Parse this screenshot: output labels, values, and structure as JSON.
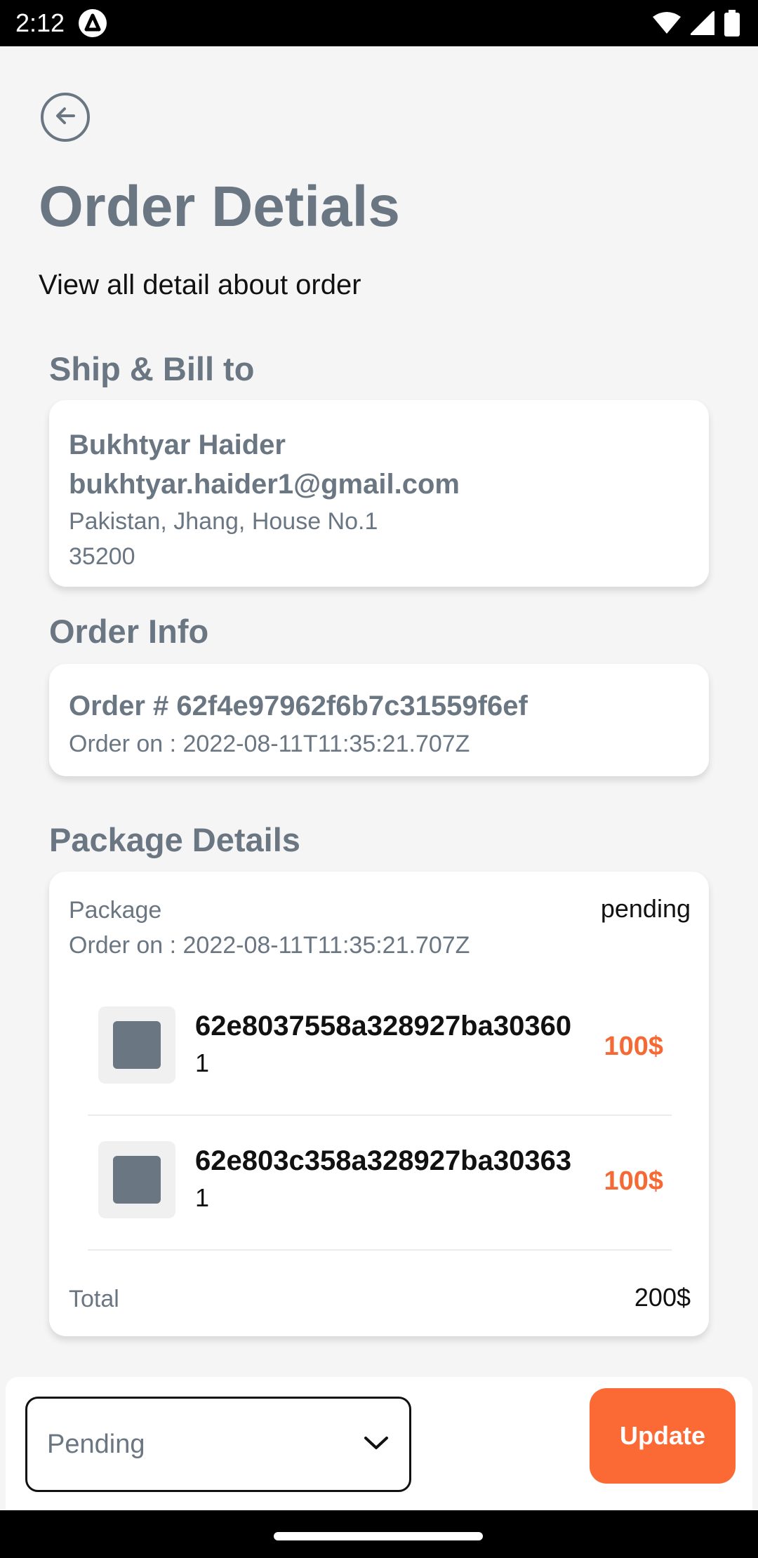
{
  "status_bar": {
    "time": "2:12",
    "icons": [
      "wifi-icon",
      "signal-icon",
      "battery-icon"
    ]
  },
  "header": {
    "title": "Order Detials",
    "subtitle": "View all detail about order"
  },
  "ship_bill": {
    "section_title": "Ship & Bill to",
    "name": "Bukhtyar Haider",
    "email": "bukhtyar.haider1@gmail.com",
    "address": "Pakistan, Jhang, House No.1",
    "postal_code": "35200"
  },
  "order_info": {
    "section_title": "Order Info",
    "order_id": "Order # 62f4e97962f6b7c31559f6ef",
    "order_date": "Order on : 2022-08-11T11:35:21.707Z"
  },
  "package": {
    "section_title": "Package Details",
    "label": "Package",
    "status": "pending",
    "order_date": "Order on : 2022-08-11T11:35:21.707Z",
    "items": [
      {
        "id": "62e8037558a328927ba30360",
        "qty": "1",
        "price": "100$"
      },
      {
        "id": "62e803c358a328927ba30363",
        "qty": "1",
        "price": "100$"
      }
    ],
    "total_label": "Total",
    "total_value": "200$"
  },
  "bottom": {
    "select_value": "Pending",
    "update_label": "Update"
  },
  "colors": {
    "accent": "#fb6a35",
    "price": "#f56a34",
    "muted": "#6b7683"
  }
}
